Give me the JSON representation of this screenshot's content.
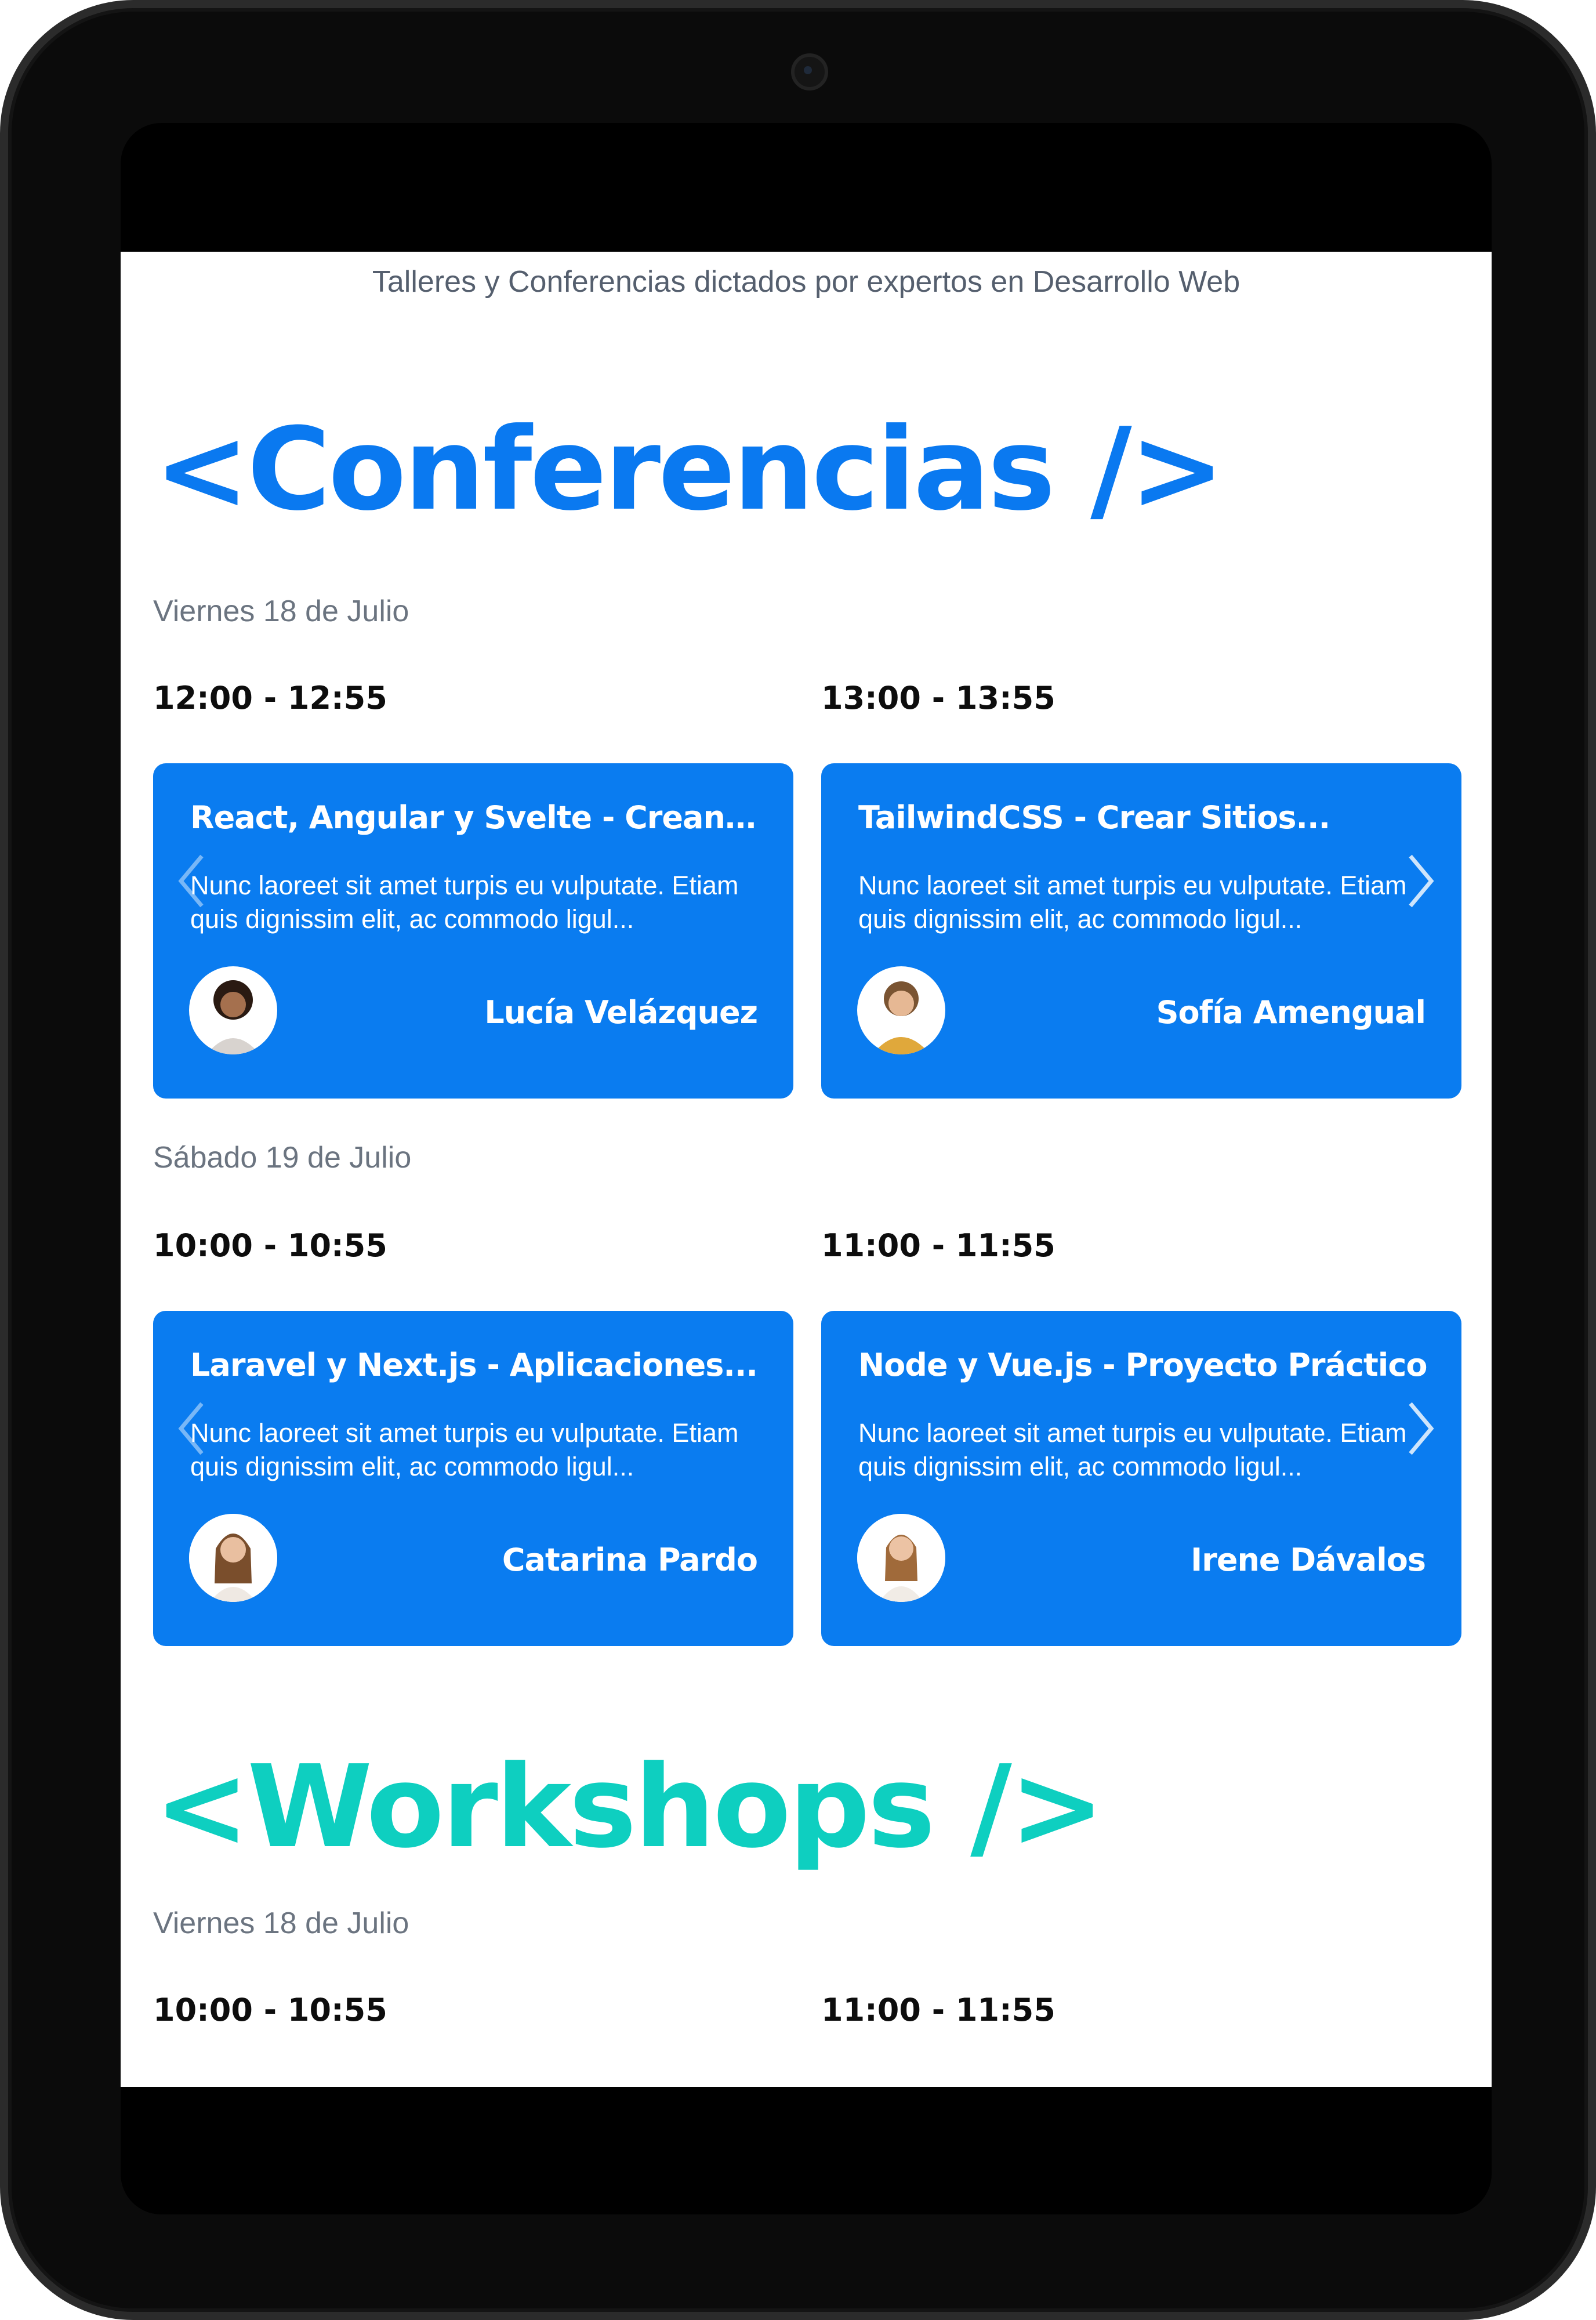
{
  "subtitle": "Talleres y Conferencias dictados por expertos en Desarrollo Web",
  "conferencias": {
    "heading": "<Conferencias />",
    "days": [
      {
        "label": "Viernes 18 de Julio",
        "events": [
          {
            "time": "12:00 - 12:55",
            "title": "React, Angular y Svelte - Creand...",
            "description": "Nunc laoreet sit amet turpis eu vulputate. Etiam quis dignissim elit, ac commodo ligul...",
            "speaker": "Lucía Velázquez",
            "avatar_color": "#d8d3cf"
          },
          {
            "time": "13:00 - 13:55",
            "title": "TailwindCSS - Crear Sitios...",
            "description": "Nunc laoreet sit amet turpis eu vulputate. Etiam quis dignissim elit, ac commodo ligul...",
            "speaker": "Sofía Amengual",
            "avatar_color": "#e0a83b"
          }
        ]
      },
      {
        "label": "Sábado 19 de Julio",
        "events": [
          {
            "time": "10:00 - 10:55",
            "title": "Laravel y Next.js - Aplicaciones...",
            "description": "Nunc laoreet sit amet turpis eu vulputate. Etiam quis dignissim elit, ac commodo ligul...",
            "speaker": "Catarina Pardo",
            "avatar_color": "#efe9e3"
          },
          {
            "time": "11:00 - 11:55",
            "title": "Node y Vue.js - Proyecto Práctico",
            "description": "Nunc laoreet sit amet turpis eu vulputate. Etiam quis dignissim elit, ac commodo ligul...",
            "speaker": "Irene Dávalos",
            "avatar_color": "#f1ece6"
          }
        ]
      }
    ]
  },
  "workshops": {
    "heading": "<Workshops />",
    "days": [
      {
        "label": "Viernes 18 de Julio",
        "times": [
          "10:00 - 10:55",
          "11:00 - 11:55"
        ]
      }
    ]
  },
  "colors": {
    "conferencias_accent": "#0a79f0",
    "workshops_accent": "#0ecfc0",
    "card_background": "#0a7cf0"
  },
  "icons": {
    "prev": "chevron-left-icon",
    "next": "chevron-right-icon"
  }
}
